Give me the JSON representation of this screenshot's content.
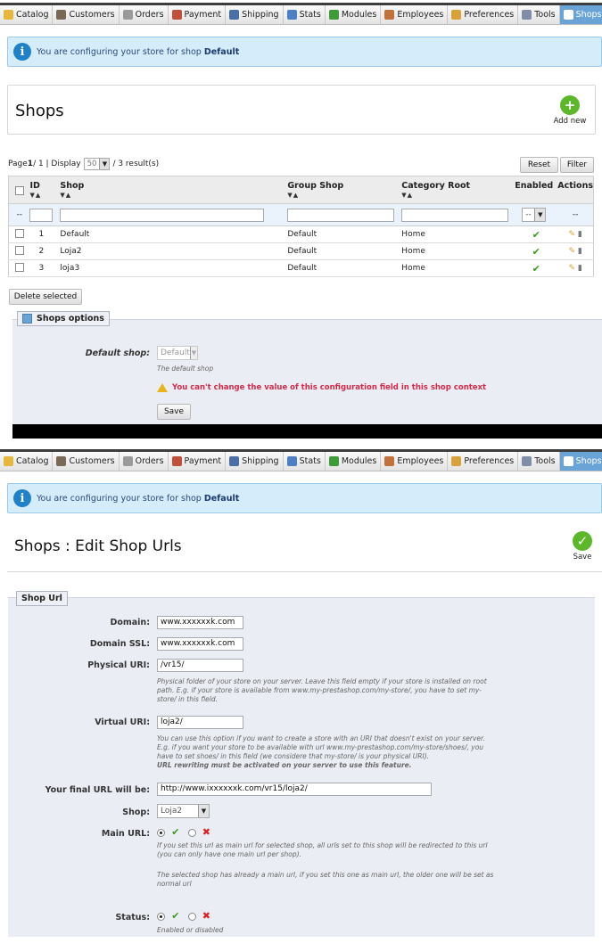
{
  "nav": {
    "tabs": [
      {
        "label": "Catalog",
        "icon": "folder-icon",
        "color": "#e5b73b"
      },
      {
        "label": "Customers",
        "icon": "user-icon",
        "color": "#7a6a55"
      },
      {
        "label": "Orders",
        "icon": "cart-icon",
        "color": "#9a9a9a"
      },
      {
        "label": "Payment",
        "icon": "payment-icon",
        "color": "#c0503c"
      },
      {
        "label": "Shipping",
        "icon": "truck-icon",
        "color": "#4a6fa5"
      },
      {
        "label": "Stats",
        "icon": "chart-icon",
        "color": "#4d7fc4"
      },
      {
        "label": "Modules",
        "icon": "puzzle-icon",
        "color": "#3f9a3a"
      },
      {
        "label": "Employees",
        "icon": "employee-icon",
        "color": "#c2713a"
      },
      {
        "label": "Preferences",
        "icon": "preferences-icon",
        "color": "#d8a23a"
      },
      {
        "label": "Tools",
        "icon": "wrench-icon",
        "color": "#7f8ea6"
      },
      {
        "label": "Shops",
        "icon": "shop-icon",
        "color": "#ffffff"
      }
    ],
    "active": "Shops"
  },
  "info": {
    "text": "You are configuring your store for shop ",
    "shop": "Default"
  },
  "list_page": {
    "title": "Shops",
    "add_new": "Add new",
    "pager": {
      "page_label": "Page ",
      "current": "1",
      "of": " / 1 | Display ",
      "per_page": "50",
      "results": " / 3 result(s)"
    },
    "reset": "Reset",
    "filter": "Filter",
    "columns": [
      "ID",
      "Shop",
      "Group Shop",
      "Category Root",
      "Enabled",
      "Actions"
    ],
    "filter_dash": "--",
    "enabled_filter": "--",
    "rows": [
      {
        "id": "1",
        "shop": "Default",
        "group": "Default",
        "category": "Home"
      },
      {
        "id": "2",
        "shop": "Loja2",
        "group": "Default",
        "category": "Home"
      },
      {
        "id": "3",
        "shop": "loja3",
        "group": "Default",
        "category": "Home"
      }
    ],
    "delete_selected": "Delete selected",
    "options": {
      "legend": "Shops options",
      "default_shop_label": "Default shop:",
      "default_shop_value": "Default",
      "default_shop_hint": "The default shop",
      "warning": "You can't change the value of this configuration field in this shop context",
      "save": "Save"
    }
  },
  "edit_page": {
    "title": "Shops : Edit Shop Urls",
    "save": "Save",
    "legend": "Shop Url",
    "fields": {
      "domain_label": "Domain:",
      "domain_value": "www.xxxxxxk.com",
      "domain_ssl_label": "Domain SSL:",
      "domain_ssl_value": "www.xxxxxxk.com",
      "physical_label": "Physical URI:",
      "physical_value": "/vr15/",
      "physical_hint": "Physical folder of your store on your server. Leave this field empty if your store is installed on root path. E.g. if your store is available from www.my-prestashop.com/my-store/, you have to set my-store/ in this field.",
      "virtual_label": "Virtual URI:",
      "virtual_value": "loja2/",
      "virtual_hint": "You can use this option if you want to create a store with an URI that doesn't exist on your server. E.g. if you want your store to be available with url www.my-prestashop.com/my-store/shoes/, you have to set shoes/ in this field (we considere that my-store/ is your physical URI).",
      "virtual_hint_bold": "URL rewriting must be activated on your server to use this feature.",
      "final_label": "Your final URL will be:",
      "final_value": "http://www.ixxxxxxk.com/vr15/loja2/",
      "shop_label": "Shop:",
      "shop_value": "Loja2",
      "main_label": "Main URL:",
      "main_hint": "If you set this url as main url for selected shop, all urls set to this shop will be redirected to this url (you can only have one main url per shop).",
      "main_hint2": "The selected shop has already a main url, if you set this one as main url, the older one will be set as normal url",
      "status_label": "Status:",
      "status_hint": "Enabled or disabled"
    }
  }
}
